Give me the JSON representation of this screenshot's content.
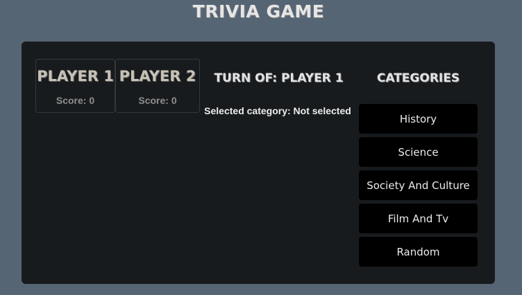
{
  "header": {
    "title": "TRIVIA GAME"
  },
  "players": [
    {
      "name": "PLAYER 1",
      "score_text": "Score: 0"
    },
    {
      "name": "PLAYER 2",
      "score_text": "Score: 0"
    }
  ],
  "status": {
    "turn_text": "TURN OF: PLAYER 1",
    "selected_text": "Selected category: Not selected"
  },
  "categories": {
    "heading": "CATEGORIES",
    "items": [
      {
        "label": "History"
      },
      {
        "label": "Science"
      },
      {
        "label": "Society And Culture"
      },
      {
        "label": "Film And Tv"
      },
      {
        "label": "Random"
      }
    ]
  },
  "colors": {
    "page_background": "#566574",
    "board_background": "#181b1d",
    "button_background": "#000000"
  }
}
